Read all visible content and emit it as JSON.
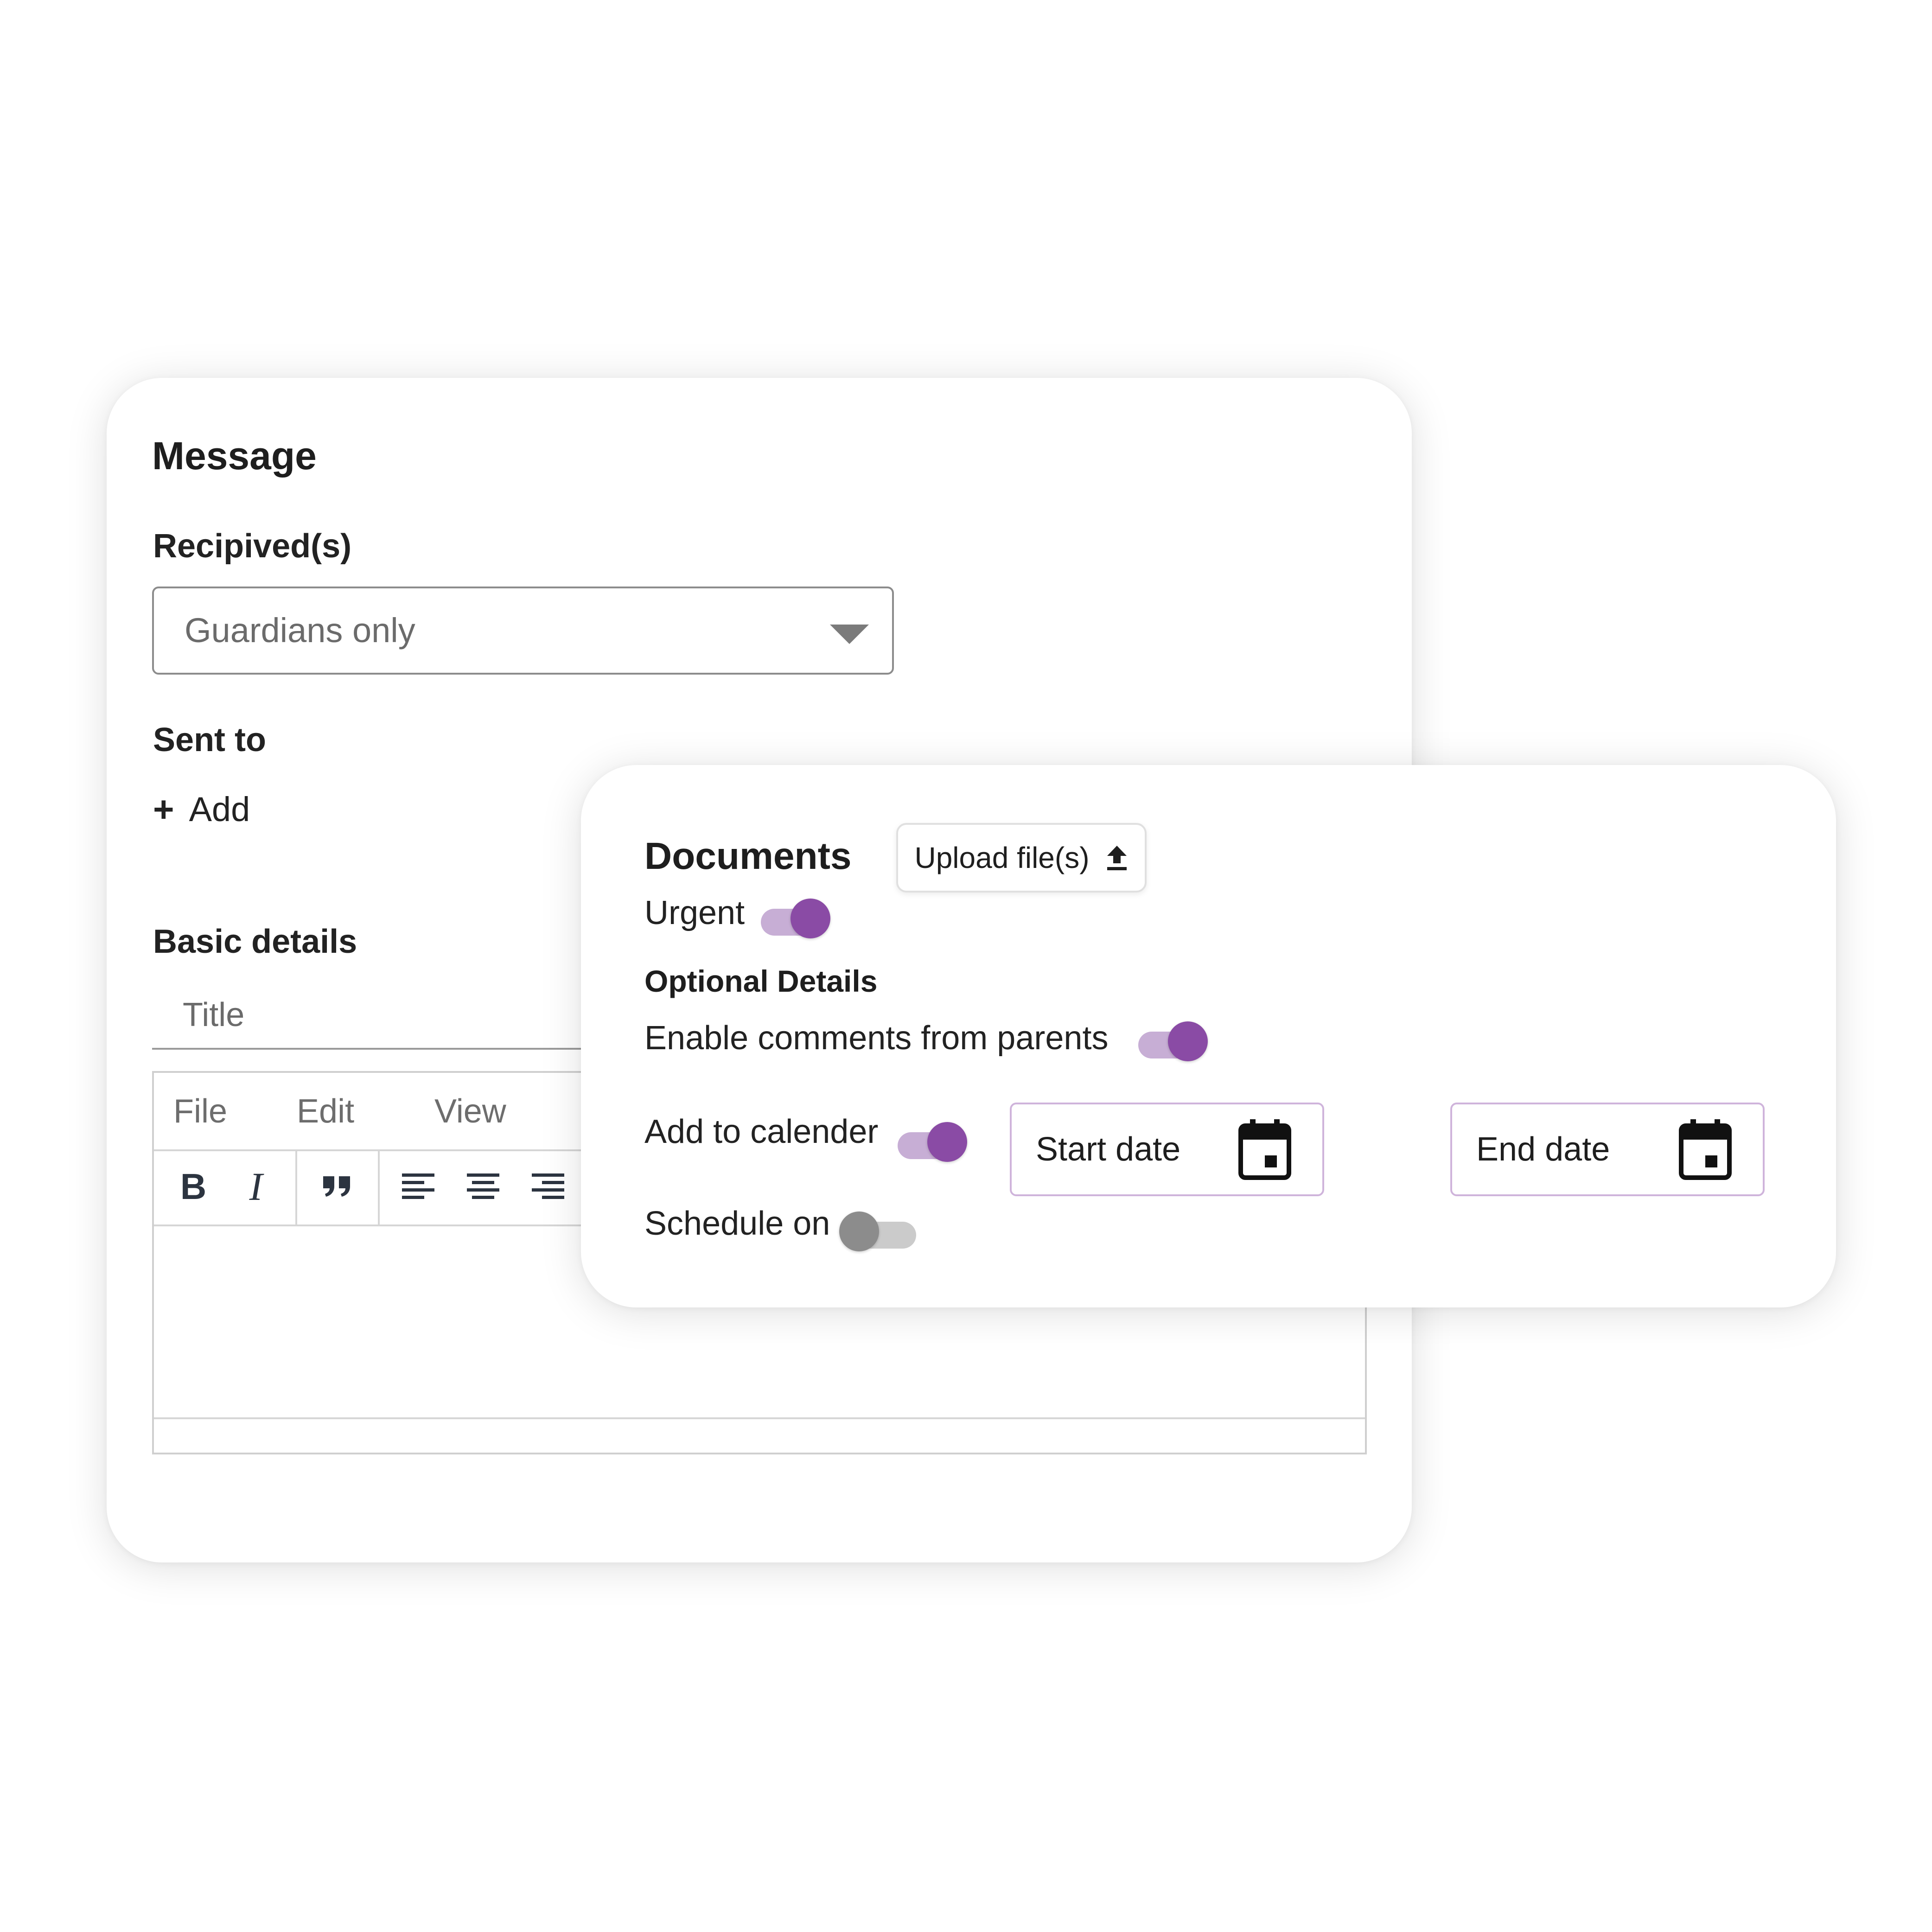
{
  "message_card": {
    "title": "Message",
    "recipients_label": "Recipived(s)",
    "recipients_value": "Guardians only",
    "sent_to_label": "Sent to",
    "add_plus": "+",
    "add_label": "Add",
    "basic_details_label": "Basic details",
    "title_placeholder": "Title",
    "editor": {
      "menu": [
        "File",
        "Edit",
        "View"
      ],
      "toolbar": {
        "bold": "B",
        "italic": "I"
      }
    }
  },
  "documents_card": {
    "title": "Documents",
    "upload_label": "Upload file(s)",
    "urgent_label": "Urgent",
    "urgent_on": true,
    "optional_title": "Optional Details",
    "comments_label": "Enable comments from parents",
    "comments_on": true,
    "calendar_label": "Add to calender",
    "calendar_on": true,
    "start_date_label": "Start date",
    "end_date_label": "End date",
    "schedule_label": "Schedule on",
    "schedule_on": false
  },
  "colors": {
    "accent": "#8a4ba5",
    "accent_light": "#c7aed5",
    "toggle_off_knob": "#8c8c8c",
    "toggle_off_track": "#cbcbcb",
    "date_border": "#cfb4db"
  },
  "icons": {
    "dropdown": "chevron-down-icon",
    "upload": "upload-icon",
    "calendar": "calendar-icon",
    "quote": "quote-icon",
    "align_left": "align-left-icon",
    "align_center": "align-center-icon",
    "align_right": "align-right-icon"
  }
}
